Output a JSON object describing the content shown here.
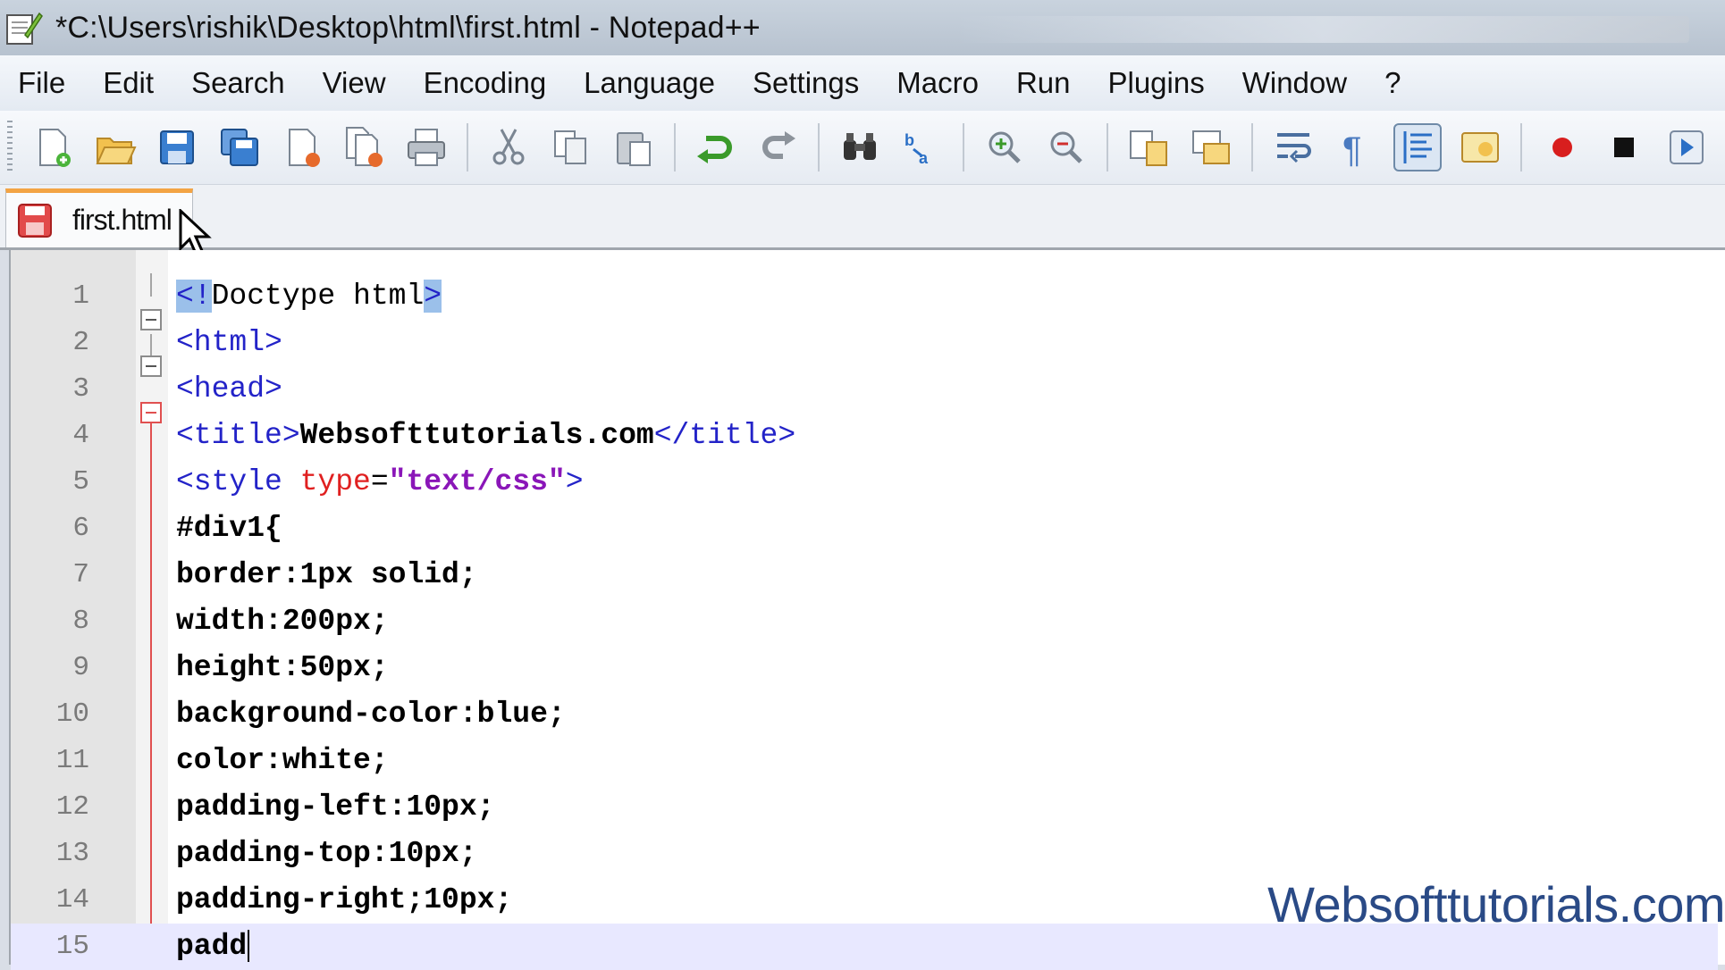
{
  "window": {
    "title": "*C:\\Users\\rishik\\Desktop\\html\\first.html - Notepad++"
  },
  "menu": [
    "File",
    "Edit",
    "Search",
    "View",
    "Encoding",
    "Language",
    "Settings",
    "Macro",
    "Run",
    "Plugins",
    "Window",
    "?"
  ],
  "tab": {
    "label": "first.html"
  },
  "editor": {
    "line_numbers": [
      "1",
      "2",
      "3",
      "4",
      "5",
      "6",
      "7",
      "8",
      "9",
      "10",
      "11",
      "12",
      "13",
      "14",
      "15"
    ],
    "lines": {
      "l1_open": "<!",
      "l1_mid": "Doctype html",
      "l1_close": ">",
      "l2": "<html>",
      "l3": "<head>",
      "l4_open": "<title>",
      "l4_text": "Websofttutorials.com",
      "l4_close": "</title>",
      "l5_tag": "<style ",
      "l5_attr": "type",
      "l5_eq": "=",
      "l5_val": "\"text/css\"",
      "l5_end": ">",
      "l6": "#div1{",
      "l7": "border:1px solid;",
      "l8": "width:200px;",
      "l9": "height:50px;",
      "l10": "background-color:blue;",
      "l11": "color:white;",
      "l12": "padding-left:10px;",
      "l13": "padding-top:10px;",
      "l14": "padding-right;10px;",
      "l15": "padd"
    }
  },
  "watermark": "Websofttutorials.com",
  "colors": {
    "tag": "#2323c8",
    "attribute": "#e02020",
    "string": "#8a16b8",
    "selection": "#9bc0ea",
    "current_line": "#e8e8ff",
    "tab_accent": "#f3a444"
  }
}
